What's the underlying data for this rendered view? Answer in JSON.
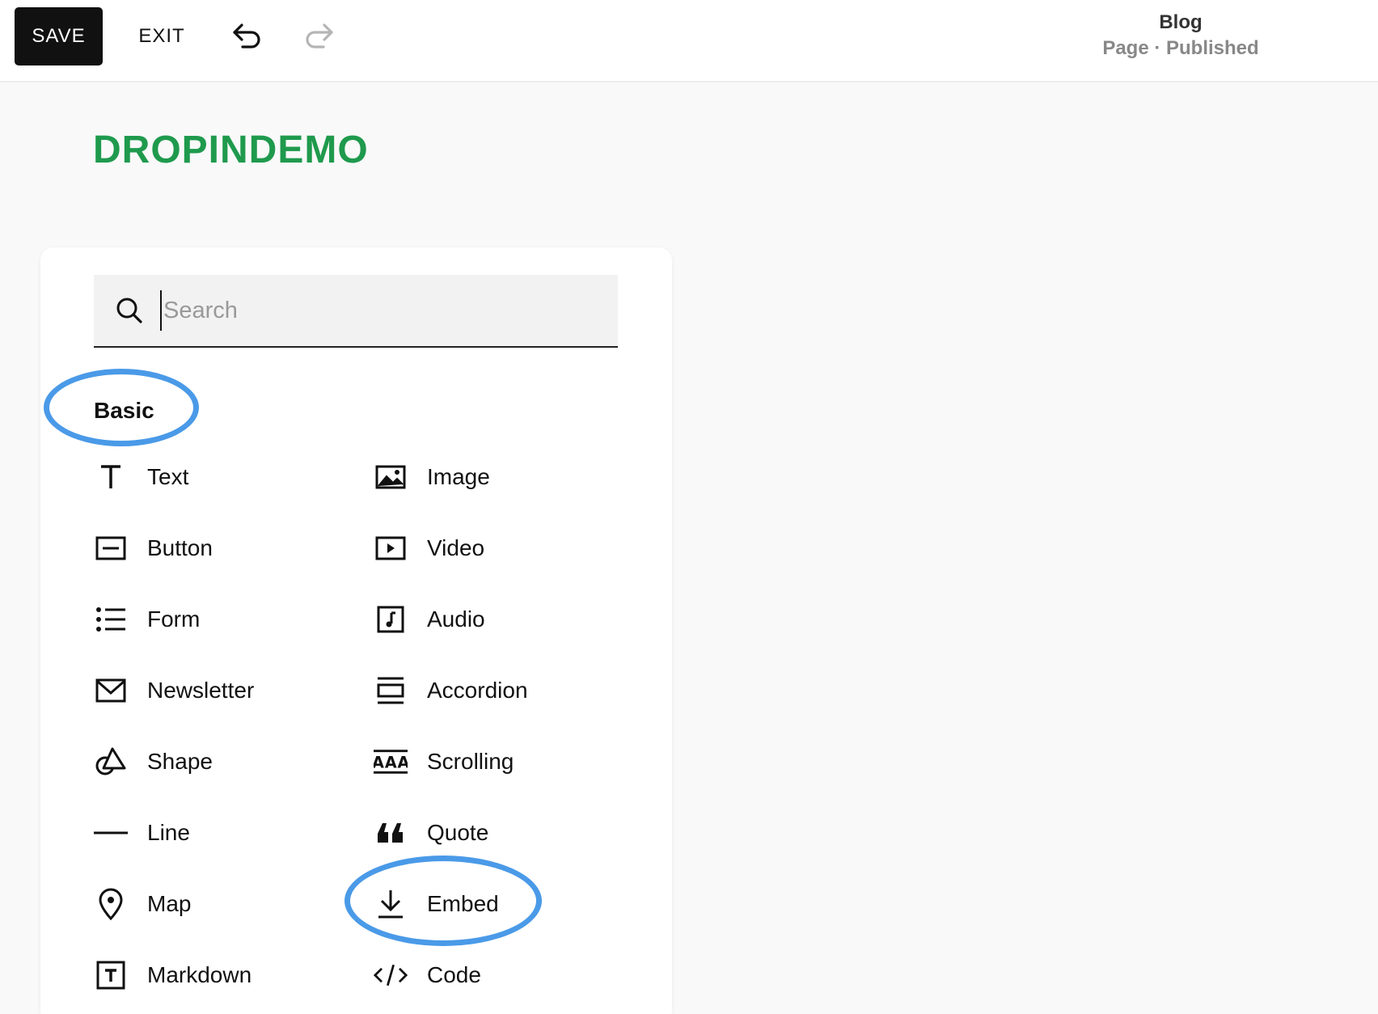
{
  "toolbar": {
    "save_label": "SAVE",
    "exit_label": "EXIT",
    "undo_icon": "undo-arrow-icon",
    "redo_icon": "redo-arrow-icon"
  },
  "page_info": {
    "title": "Blog",
    "status": "Page · Published"
  },
  "site": {
    "brand": "DROPINDEMO",
    "brand_color": "#1f9a4d"
  },
  "block_picker": {
    "search_placeholder": "Search",
    "search_value": "",
    "section_label": "Basic",
    "highlight_color": "#4a9ae8",
    "items": [
      {
        "label": "Text",
        "icon": "text-icon"
      },
      {
        "label": "Image",
        "icon": "image-icon"
      },
      {
        "label": "Button",
        "icon": "button-icon"
      },
      {
        "label": "Video",
        "icon": "video-icon"
      },
      {
        "label": "Form",
        "icon": "form-list-icon"
      },
      {
        "label": "Audio",
        "icon": "audio-icon"
      },
      {
        "label": "Newsletter",
        "icon": "envelope-icon"
      },
      {
        "label": "Accordion",
        "icon": "accordion-icon"
      },
      {
        "label": "Shape",
        "icon": "shape-icon"
      },
      {
        "label": "Scrolling",
        "icon": "scrolling-text-icon"
      },
      {
        "label": "Line",
        "icon": "line-icon"
      },
      {
        "label": "Quote",
        "icon": "quote-icon"
      },
      {
        "label": "Map",
        "icon": "map-pin-icon"
      },
      {
        "label": "Embed",
        "icon": "embed-download-icon"
      },
      {
        "label": "Markdown",
        "icon": "markdown-icon"
      },
      {
        "label": "Code",
        "icon": "code-icon"
      }
    ]
  }
}
